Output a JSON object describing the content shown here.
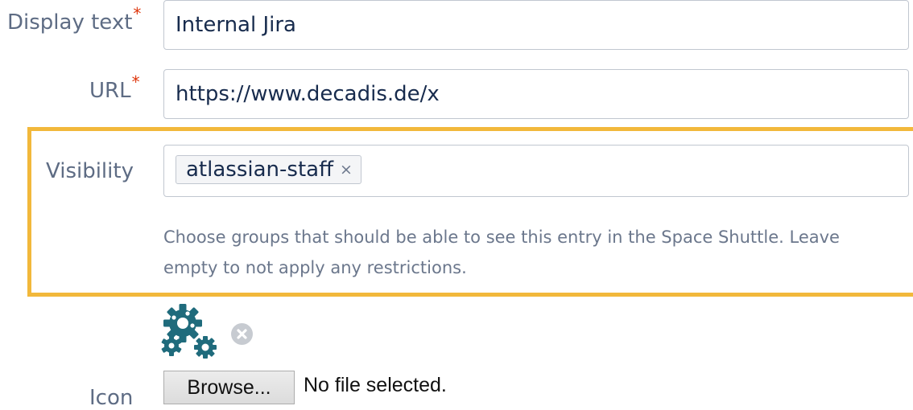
{
  "form": {
    "display_text": {
      "label": "Display text",
      "required_mark": "*",
      "value": "Internal Jira"
    },
    "url": {
      "label": "URL",
      "required_mark": "*",
      "value": "https://www.decadis.de/x"
    },
    "visibility": {
      "label": "Visibility",
      "tags": [
        {
          "label": "atlassian-staff",
          "remove_glyph": "×"
        }
      ],
      "help_line_1": "Choose groups that should be able to see this entry in the Space Shuttle. Leave",
      "help_line_2": "empty to not apply any restrictions."
    },
    "icon": {
      "label": "Icon",
      "preview_icon": "gears-icon",
      "remove_icon": "remove-circle-icon",
      "browse_label": "Browse...",
      "file_status": "No file selected."
    }
  },
  "colors": {
    "highlight_border": "#f2b83b",
    "required_star": "#de350b",
    "gear_icon": "#1f6b7c",
    "label_text": "#5e6c84"
  }
}
